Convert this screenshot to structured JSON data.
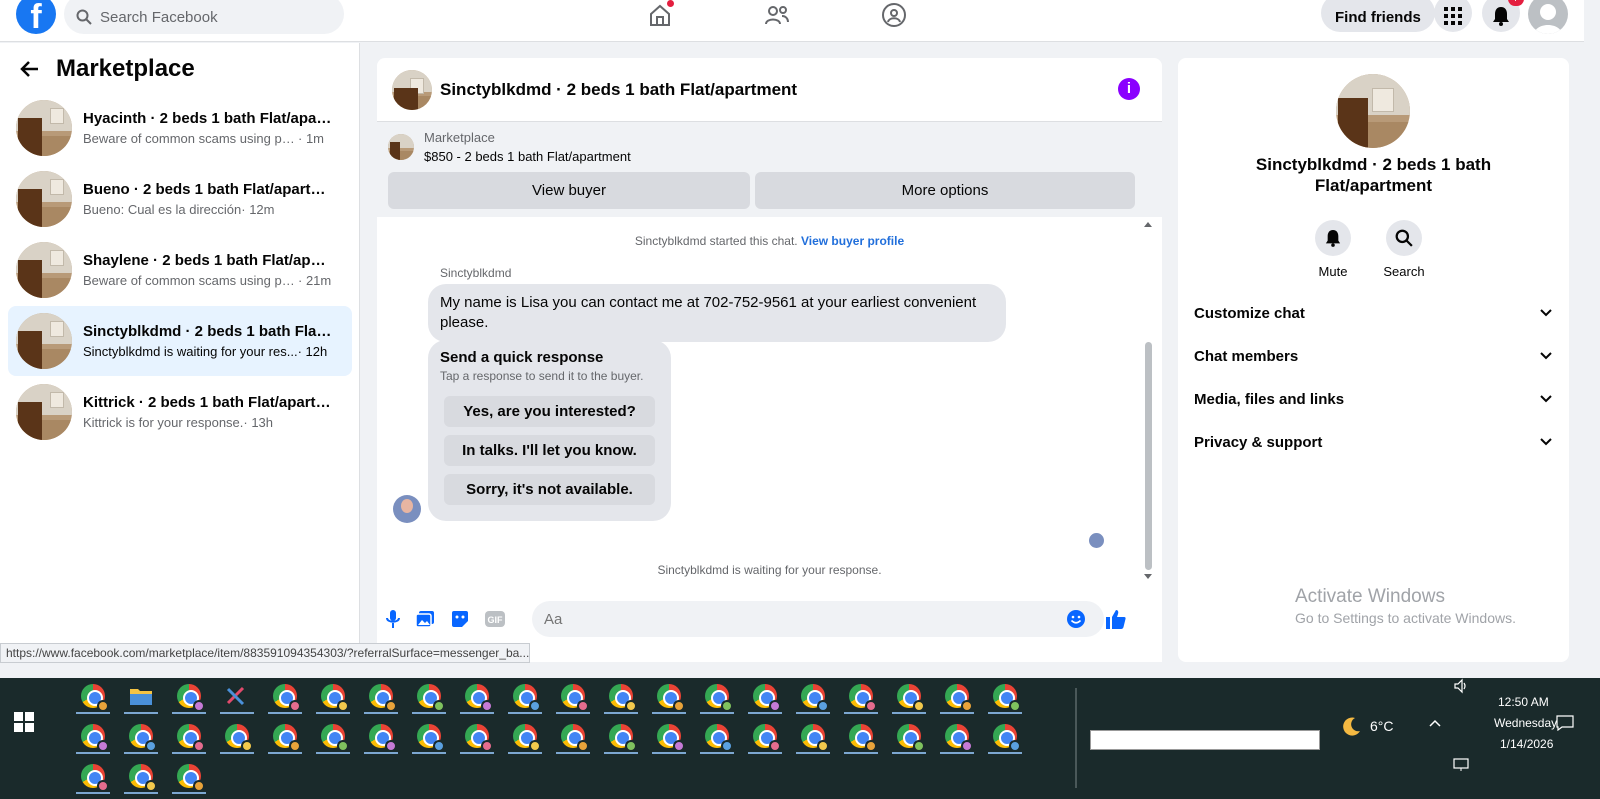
{
  "topbar": {
    "search_placeholder": "Search Facebook",
    "find_friends": "Find friends",
    "notification_count": "7"
  },
  "marketplace": {
    "title": "Marketplace",
    "conversations": [
      {
        "title": "Hyacinth · 2 beds 1 bath Flat/apart...",
        "snippet": "Beware of common scams using pay...",
        "time": " · 1m"
      },
      {
        "title": "Bueno · 2 beds 1 bath Flat/apartm...",
        "snippet": "Bueno: Cual es la dirección",
        "time": " · 12m"
      },
      {
        "title": "Shaylene · 2 beds 1 bath Flat/apart...",
        "snippet": "Beware of common scams using pa...",
        "time": " · 21m"
      },
      {
        "title": "Sinctyblkdmd · 2 beds 1 bath Flat/...",
        "snippet": "Sinctyblkdmd is waiting for your res...",
        "time": " · 12h"
      },
      {
        "title": "Kittrick · 2 beds 1 bath Flat/apartm...",
        "snippet": "Kittrick is for your response.",
        "time": " · 13h"
      }
    ]
  },
  "chat": {
    "title": "Sinctyblkdmd · 2 beds 1 bath Flat/apartment",
    "listing_label": "Marketplace",
    "listing_price": "$850 - 2 beds 1 bath Flat/apartment",
    "view_buyer": "View buyer",
    "more_options": "More options",
    "started_text": "Sinctyblkdmd started this chat.",
    "view_buyer_profile": "View buyer profile",
    "sender": "Sinctyblkdmd",
    "message": "My name is Lisa you can contact me at 702-752-9561 at your earliest convenient please.",
    "quick_title": "Send a quick response",
    "quick_sub": "Tap a response to send it to the buyer.",
    "quick_responses": [
      "Yes, are you interested?",
      "In talks. I'll let you know.",
      "Sorry, it's not available."
    ],
    "waiting_text": "Sinctyblkdmd is waiting for your response.",
    "composer_placeholder": "Aa"
  },
  "details": {
    "title": "Sinctyblkdmd · 2 beds 1 bath Flat/apartment",
    "mute": "Mute",
    "search": "Search",
    "sections": [
      "Customize chat",
      "Chat members",
      "Media, files and links",
      "Privacy & support"
    ]
  },
  "watermark": {
    "line1": "Activate Windows",
    "line2": "Go to Settings to activate Windows."
  },
  "status_url": "https://www.facebook.com/marketplace/item/883591094354303/?referralSurface=messenger_ba...",
  "taskbar": {
    "temperature": "6°C",
    "time": "12:50 AM",
    "day": "Wednesday",
    "date": "1/14/2026"
  },
  "colors": {
    "brand_blue": "#1877f2",
    "active_conversation": "#e7f3ff",
    "info_purple": "#8a00ff",
    "link_blue": "#216fdb",
    "taskbar": "#1a2a2b"
  }
}
